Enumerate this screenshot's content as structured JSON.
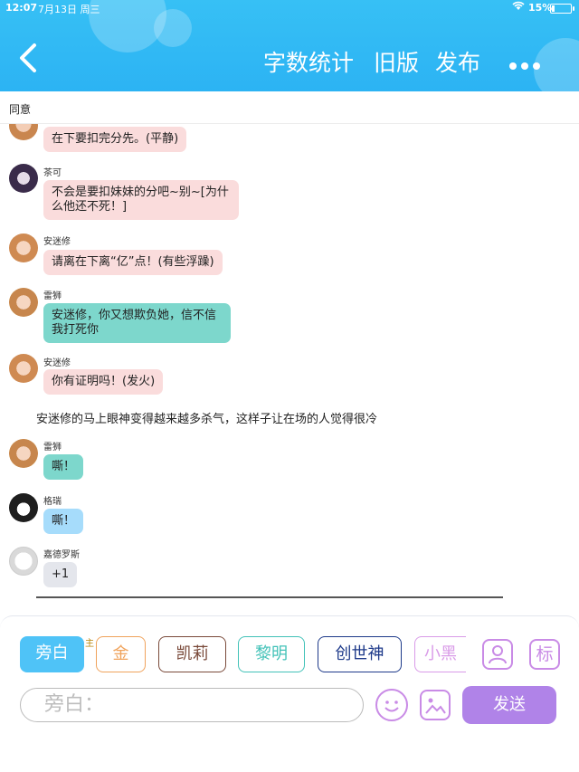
{
  "status": {
    "time": "12:07",
    "date": "7月13日 周三",
    "battery": "15%",
    "battery_level": 0.15
  },
  "header": {
    "back_icon": "chevron-left-icon",
    "word_count": "字数统计",
    "old_version": "旧版",
    "publish": "发布",
    "more_icon": "more-dots-icon"
  },
  "agree": "同意",
  "messages": [
    {
      "name": "",
      "text": "在下要扣完分先。(平静)"
    },
    {
      "name": "茶可",
      "text": "不会是要扣妹妹的分吧~别~[为什么他还不死！]"
    },
    {
      "name": "安迷修",
      "text": "请离在下离“亿”点！(有些浮躁)"
    },
    {
      "name": "雷狮",
      "text": "安迷修，你又想欺负她，信不信我打死你"
    },
    {
      "name": "安迷修",
      "text": "你有证明吗！(发火)"
    },
    {
      "name": "雷狮",
      "text": "嘶！"
    },
    {
      "name": "格瑞",
      "text": "嘶！"
    },
    {
      "name": "嘉德罗斯",
      "text": "+1"
    }
  ],
  "narration": "安迷修的马上眼神变得越来越多杀气，这样子让在场的人觉得很冷",
  "colors": {
    "header": "#2fb6f4",
    "pink_bubble": "#fadcdc",
    "teal_bubble": "#7dd7cc",
    "blue_bubble": "#a6dcfb",
    "gray_bubble": "#e4e6ec",
    "send": "#b083e8",
    "accent": "#c98be6"
  },
  "characters": {
    "narrator": "旁白",
    "crown": "主",
    "gold": "金",
    "kairi": "凯莉",
    "liming": "黎明",
    "chuangshi": "创世神",
    "xiaohei": "小黑"
  },
  "tools": {
    "person_icon": "person-icon",
    "mark_label": "标",
    "emoji_icon": "emoji-icon",
    "image_icon": "image-icon"
  },
  "input": {
    "placeholder": "旁白："
  },
  "send": "发送"
}
